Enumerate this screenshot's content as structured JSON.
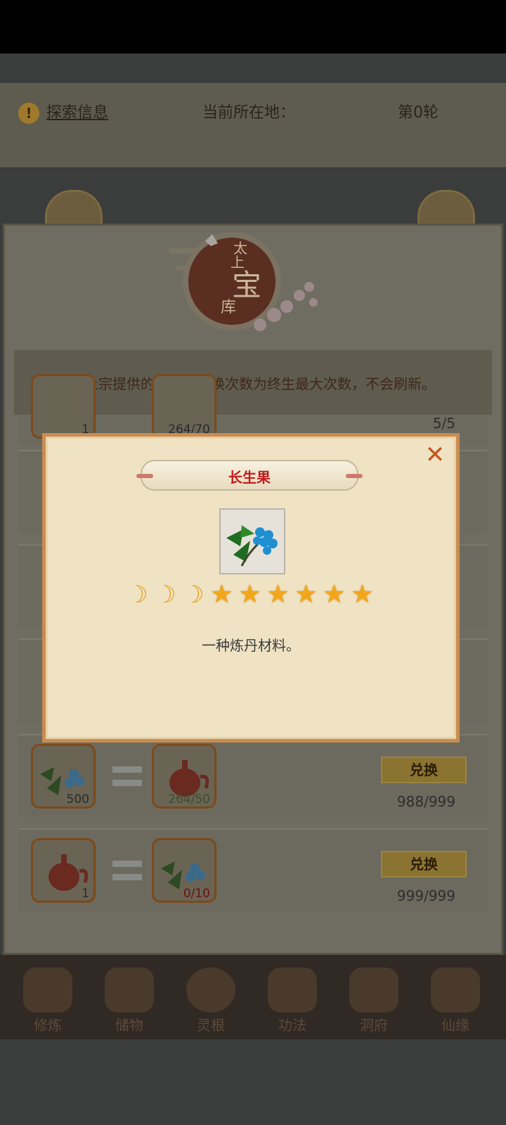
{
  "explore": {
    "info_link": "探索信息",
    "location_label": "当前所在地：",
    "round_label": "第0轮"
  },
  "treasury": {
    "seal_title_chars": [
      "太",
      "上",
      "宝",
      "库"
    ],
    "description": "太上宗提供的宝库，兑换次数为终生最大次数，不会刷新。",
    "partial_top_row": {
      "left_qty": "1",
      "right_qty": "264/70",
      "count": "5/5"
    },
    "rows": [
      {
        "left_icon": "blueberry-herb-icon",
        "left_qty": "500",
        "right_icon": "red-teapot-icon",
        "right_qty": "264/50",
        "button": "兑换",
        "count": "988/999"
      },
      {
        "left_icon": "red-teapot-icon",
        "left_qty": "1",
        "right_icon": "blueberry-herb-icon",
        "right_qty": "0/10",
        "button": "兑换",
        "count": "999/999"
      }
    ]
  },
  "modal": {
    "title": "长生果",
    "item_icon": "blueberry-herb-icon",
    "moons": 3,
    "stars": 6,
    "description": "一种炼丹材料。",
    "colors": {
      "title": "#c11c1c",
      "star": "#f2a71b"
    }
  },
  "bottom_nav": {
    "items": [
      "修炼",
      "储物",
      "灵根",
      "功法",
      "洞府",
      "仙缘"
    ]
  }
}
